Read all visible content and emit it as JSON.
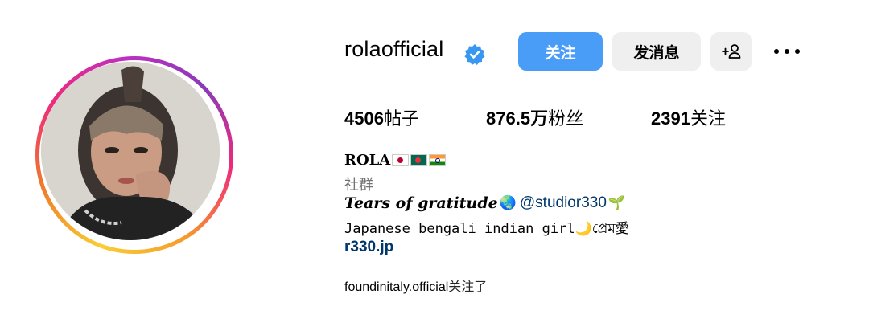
{
  "profile": {
    "username": "rolaofficial",
    "verified_icon": "verified-badge-icon"
  },
  "actions": {
    "follow_label": "关注",
    "message_label": "发消息",
    "add_user_icon_label": "+",
    "more_icon": "ellipsis-icon"
  },
  "stats": {
    "posts_count": "4506",
    "posts_label": "帖子",
    "followers_count": "876.5万",
    "followers_label": "粉丝",
    "following_count": "2391",
    "following_label": "关注"
  },
  "bio": {
    "name": "ROLA",
    "flags": [
      "Japan flag",
      "Bangladesh flag",
      "India flag"
    ],
    "category": "社群",
    "tagline": "Tears of gratitude",
    "tagline_emoji": "🌏",
    "mention": "@studior330",
    "mention_emoji": "🌱",
    "description": "Japanese bengali indian girl",
    "description_emoji": "🌙",
    "description_tail": "প্রেম愛",
    "link": "r330.jp"
  },
  "followed_by": {
    "account": "foundinitaly.official",
    "suffix": "关注了"
  },
  "colors": {
    "accent": "#4a9df6",
    "link": "#00376b",
    "secondary_text": "#737373",
    "button_gray": "#efefef"
  }
}
